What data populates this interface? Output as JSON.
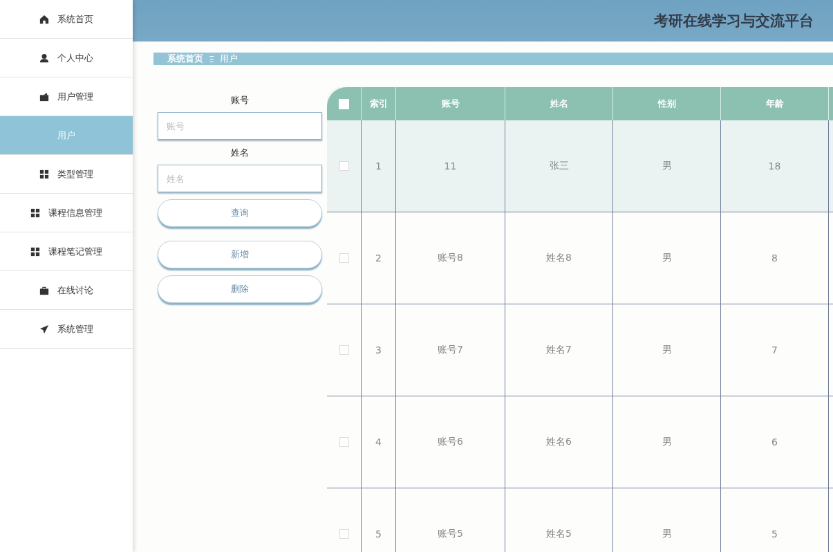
{
  "header": {
    "title": "考研在线学习与交流平台"
  },
  "sidebar": {
    "items": [
      {
        "label": "系统首页",
        "kind": "home",
        "selected": false
      },
      {
        "label": "个人中心",
        "kind": "person",
        "selected": false
      },
      {
        "label": "用户管理",
        "kind": "wallet",
        "selected": false
      },
      {
        "label": "用户",
        "kind": "sub",
        "selected": true
      },
      {
        "label": "类型管理",
        "kind": "grid",
        "selected": false
      },
      {
        "label": "课程信息管理",
        "kind": "grid",
        "selected": false
      },
      {
        "label": "课程笔记管理",
        "kind": "grid",
        "selected": false
      },
      {
        "label": "在线讨论",
        "kind": "case",
        "selected": false
      },
      {
        "label": "系统管理",
        "kind": "plane",
        "selected": false
      }
    ]
  },
  "breadcrumb": {
    "home": "系统首页",
    "separator": "Ξ",
    "current": "用户"
  },
  "search": {
    "fields": [
      {
        "label": "账号",
        "placeholder": "账号"
      },
      {
        "label": "姓名",
        "placeholder": "姓名"
      }
    ],
    "query_button": "查询"
  },
  "actions": [
    "新增",
    "删除"
  ],
  "table": {
    "all_checked": false,
    "columns": [
      "索引",
      "账号",
      "姓名",
      "性别",
      "年龄"
    ],
    "rows": [
      {
        "cells": [
          "1",
          "11",
          "张三",
          "男",
          "18"
        ],
        "checked": false,
        "highlighted": true
      },
      {
        "cells": [
          "2",
          "账号8",
          "姓名8",
          "男",
          "8"
        ],
        "checked": false,
        "highlighted": false
      },
      {
        "cells": [
          "3",
          "账号7",
          "姓名7",
          "男",
          "7"
        ],
        "checked": false,
        "highlighted": false
      },
      {
        "cells": [
          "4",
          "账号6",
          "姓名6",
          "男",
          "6"
        ],
        "checked": false,
        "highlighted": false
      },
      {
        "cells": [
          "5",
          "账号5",
          "姓名5",
          "男",
          "5"
        ],
        "checked": false,
        "highlighted": false
      }
    ]
  }
}
